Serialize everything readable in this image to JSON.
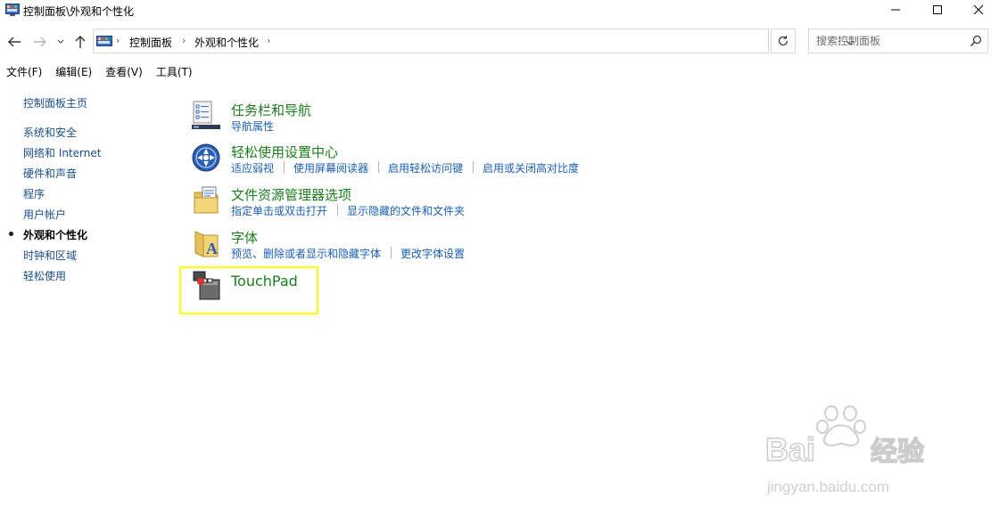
{
  "window": {
    "title": "控制面板\\外观和个性化",
    "minimize_icon": "minimize-icon",
    "maximize_icon": "maximize-icon",
    "close_icon": "close-icon"
  },
  "address_bar": {
    "breadcrumb": [
      "控制面板",
      "外观和个性化"
    ],
    "search_placeholder": "搜索控制面板"
  },
  "menu": [
    "文件(F)",
    "编辑(E)",
    "查看(V)",
    "工具(T)"
  ],
  "sidebar": {
    "home": "控制面板主页",
    "items": [
      {
        "label": "系统和安全",
        "active": false
      },
      {
        "label": "网络和 Internet",
        "active": false
      },
      {
        "label": "硬件和声音",
        "active": false
      },
      {
        "label": "程序",
        "active": false
      },
      {
        "label": "用户帐户",
        "active": false
      },
      {
        "label": "外观和个性化",
        "active": true
      },
      {
        "label": "时钟和区域",
        "active": false
      },
      {
        "label": "轻松使用",
        "active": false
      }
    ]
  },
  "categories": [
    {
      "title": "任务栏和导航",
      "icon": "taskbar-icon",
      "links": [
        "导航属性"
      ]
    },
    {
      "title": "轻松使用设置中心",
      "icon": "ease-of-access-icon",
      "links": [
        "适应弱视",
        "使用屏幕阅读器",
        "启用轻松访问键",
        "启用或关闭高对比度"
      ]
    },
    {
      "title": "文件资源管理器选项",
      "icon": "folder-options-icon",
      "links": [
        "指定单击或双击打开",
        "显示隐藏的文件和文件夹"
      ]
    },
    {
      "title": "字体",
      "icon": "fonts-folder-icon",
      "links": [
        "预览、删除或者显示和隐藏字体",
        "更改字体设置"
      ]
    },
    {
      "title": "TouchPad",
      "icon": "touchpad-icon",
      "links": []
    }
  ],
  "watermark": {
    "brand": "Bai 经验",
    "url": "jingyan.baidu.com"
  },
  "colors": {
    "category_title": "#1a7f1a",
    "link": "#1a5fb4",
    "highlight": "#ffff00"
  }
}
